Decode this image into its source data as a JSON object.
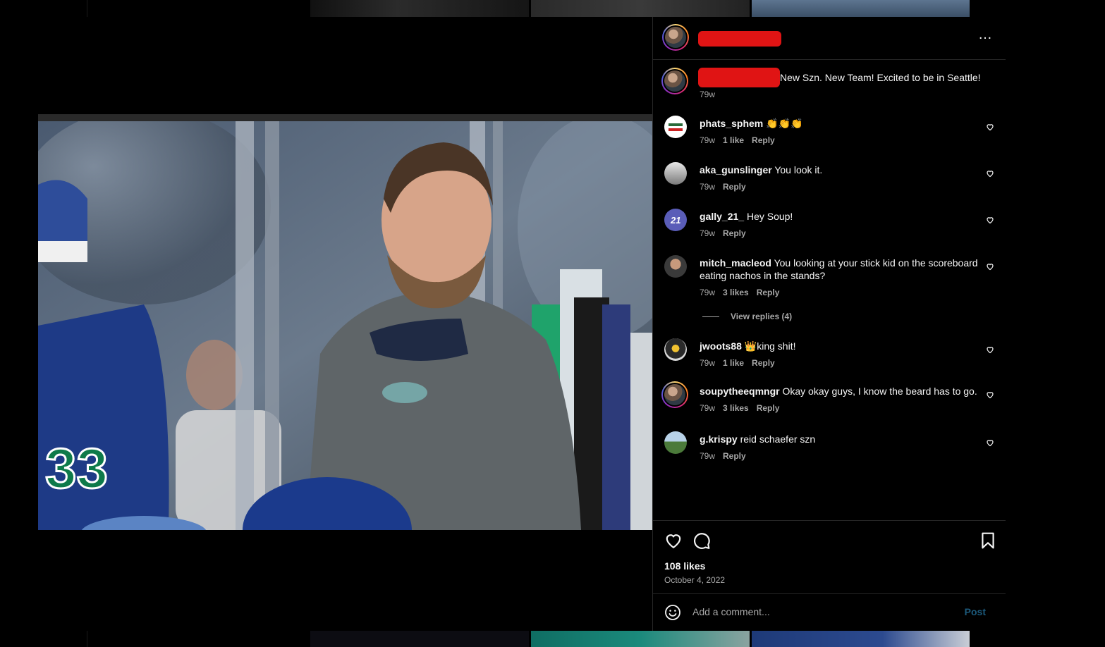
{
  "post": {
    "caption": "New Szn. New Team! Excited to be in Seattle!",
    "caption_time": "79w",
    "more_icon": "…"
  },
  "comments": [
    {
      "user": "phats_sphem",
      "text": "👏👏👏",
      "time": "79w",
      "likes": "1 like",
      "reply": "Reply"
    },
    {
      "user": "aka_gunslinger",
      "text": "You look it.",
      "time": "79w",
      "likes": "",
      "reply": "Reply"
    },
    {
      "user": "gally_21_",
      "text": "Hey Soup!",
      "time": "79w",
      "likes": "",
      "reply": "Reply"
    },
    {
      "user": "mitch_macleod",
      "text": "You looking at your stick kid on the scoreboard eating nachos in the stands?",
      "time": "79w",
      "likes": "3 likes",
      "reply": "Reply"
    },
    {
      "user": "jwoots88",
      "text": "👑king shit!",
      "time": "79w",
      "likes": "1 like",
      "reply": "Reply"
    },
    {
      "user": "soupytheeqmngr",
      "text": "Okay okay guys, I know the beard has to go.",
      "time": "79w",
      "likes": "3 likes",
      "reply": "Reply"
    },
    {
      "user": "g.krispy",
      "text": "reid schaefer szn",
      "time": "79w",
      "likes": "",
      "reply": "Reply"
    }
  ],
  "view_replies": "View replies (4)",
  "likes_count": "108 likes",
  "post_date": "October 4, 2022",
  "add_comment": {
    "placeholder": "Add a comment...",
    "post": "Post"
  },
  "colors": {
    "panel_bg": "#000000",
    "divider": "#262626",
    "muted": "#a8a8a8",
    "post_disabled": "#1c5a7c",
    "redaction": "#e01414"
  }
}
